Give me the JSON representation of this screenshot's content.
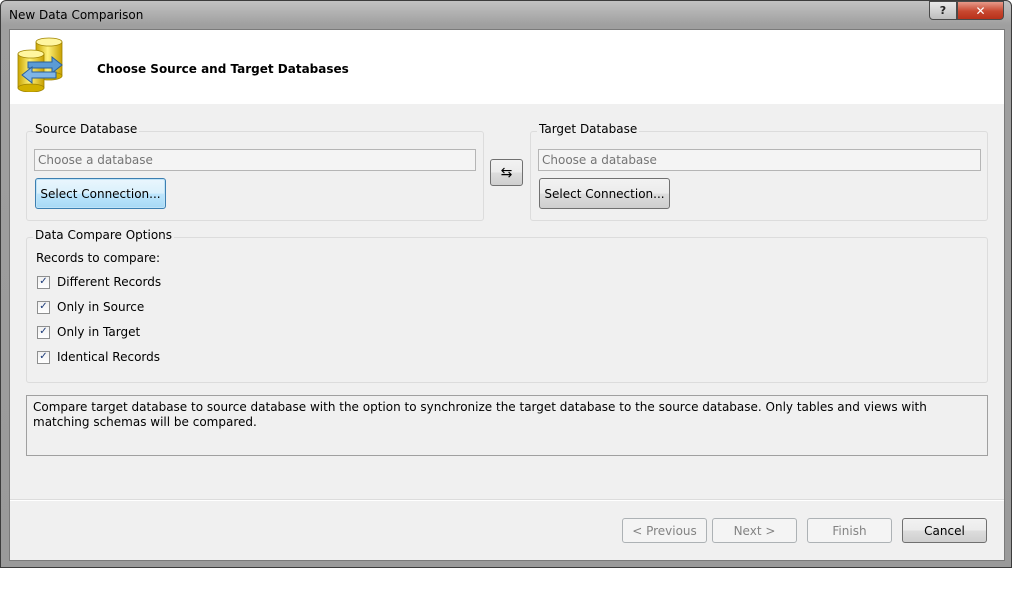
{
  "window": {
    "title": "New Data Comparison",
    "help_label": "?",
    "close_label": "✕"
  },
  "header": {
    "title": "Choose Source and Target Databases",
    "icon": "database-compare-icon"
  },
  "source": {
    "group_label": "Source Database",
    "placeholder": "Choose a database",
    "button_label": "Select Connection..."
  },
  "target": {
    "group_label": "Target Database",
    "placeholder": "Choose a database",
    "button_label": "Select Connection..."
  },
  "swap": {
    "icon": "swap-arrows-icon",
    "glyph": "⇆"
  },
  "options": {
    "group_label": "Data Compare Options",
    "records_label": "Records to compare:",
    "checkboxes": [
      {
        "label": "Different Records",
        "checked": true
      },
      {
        "label": "Only in Source",
        "checked": true
      },
      {
        "label": "Only in Target",
        "checked": true
      },
      {
        "label": "Identical Records",
        "checked": true
      }
    ]
  },
  "description": "Compare target database to source database with the option to synchronize the target database to the source database. Only tables and views with matching schemas will be compared.",
  "footer": {
    "previous_label": "< Previous",
    "next_label": "Next >",
    "finish_label": "Finish",
    "cancel_label": "Cancel"
  },
  "colors": {
    "focus_border": "#3c7fb1",
    "close_red": "#c7472f",
    "dialog_bg": "#f0f0f0"
  }
}
